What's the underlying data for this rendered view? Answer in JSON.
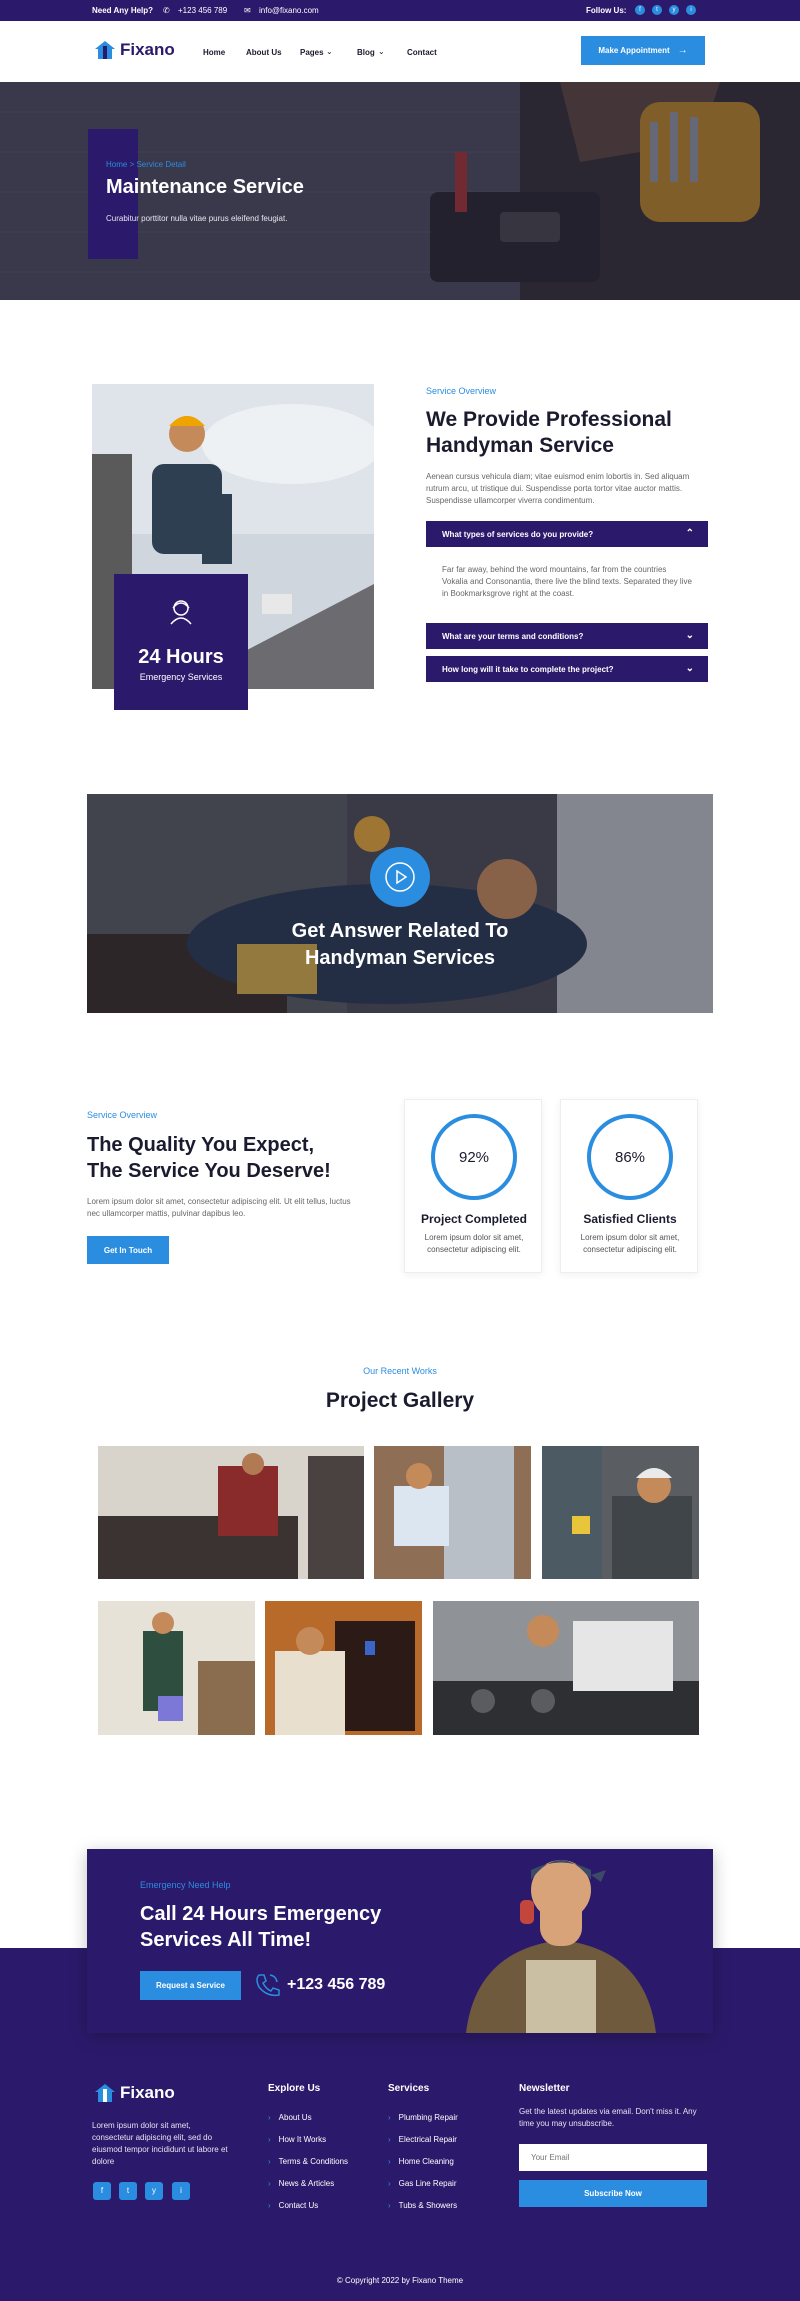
{
  "topbar": {
    "help": "Need Any Help?",
    "phone": "+123 456 789",
    "email": "info@fixano.com",
    "follow": "Follow Us:",
    "socials": [
      "f",
      "t",
      "y",
      "i"
    ]
  },
  "brand": {
    "name": "Fixano",
    "accent": "#2b8de0",
    "primary": "#2b1a6b"
  },
  "nav": {
    "items": [
      "Home",
      "About Us",
      "Pages",
      "Blog",
      "Contact"
    ],
    "cta": "Make Appointment"
  },
  "hero": {
    "breadcrumb": "Home > Service Detail",
    "title": "Maintenance Service",
    "subtitle": "Curabitur porttitor nulla vitae purus eleifend feugiat."
  },
  "overview": {
    "badge_hours": "24 Hours",
    "badge_text": "Emergency Services",
    "eyebrow": "Service Overview",
    "title_line1": "We Provide Professional",
    "title_line2": "Handyman Service",
    "text": "Aenean cursus vehicula diam; vitae euismod enim lobortis in. Sed aliquam rutrum arcu, ut tristique dui. Suspendisse porta tortor vitae auctor mattis. Suspendisse ullamcorper viverra condimentum.",
    "faq": [
      {
        "q": "What types of services do you provide?",
        "a": "Far far away, behind the word mountains, far from the countries Vokalia and Consonantia, there live the blind texts. Separated they live in Bookmarksgrove right at the coast."
      },
      {
        "q": "What are your terms and conditions?"
      },
      {
        "q": "How long will it take to complete the project?"
      }
    ]
  },
  "video": {
    "title_line1": "Get Answer Related To",
    "title_line2": "Handyman Services"
  },
  "quality": {
    "eyebrow": "Service Overview",
    "title_line1": "The Quality You Expect,",
    "title_line2": "The Service You Deserve!",
    "text": "Lorem ipsum dolor sit amet, consectetur adipiscing elit. Ut elit tellus, luctus nec ullamcorper mattis, pulvinar dapibus leo.",
    "cta": "Get In Touch",
    "stats": [
      {
        "value": "92%",
        "label": "Project Completed",
        "desc": "Lorem ipsum dolor sit amet, consectetur adipiscing elit."
      },
      {
        "value": "86%",
        "label": "Satisfied Clients",
        "desc": "Lorem ipsum dolor sit amet, consectetur adipiscing elit."
      }
    ]
  },
  "gallery": {
    "eyebrow": "Our Recent Works",
    "title": "Project Gallery"
  },
  "emergency": {
    "eyebrow": "Emergency Need Help",
    "title_line1": "Call 24 Hours Emergency",
    "title_line2": "Services All Time!",
    "cta": "Request a Service",
    "phone": "+123 456 789"
  },
  "footer": {
    "about": "Lorem ipsum dolor sit amet, consectetur adipiscing elit, sed do eiusmod tempor incididunt ut labore et dolore",
    "explore_title": "Explore Us",
    "explore": [
      "About Us",
      "How It Works",
      "Terms & Conditions",
      "News & Articles",
      "Contact Us"
    ],
    "services_title": "Services",
    "services": [
      "Plumbing Repair",
      "Electrical Repair",
      "Home Cleaning",
      "Gas Line Repair",
      "Tubs & Showers"
    ],
    "newsletter_title": "Newsletter",
    "newsletter_text": "Get the latest updates via email. Don't miss it. Any time you may unsubscribe.",
    "email_placeholder": "Your Email",
    "subscribe": "Subscribe Now",
    "copyright": "© Copyright 2022 by Fixano Theme"
  }
}
